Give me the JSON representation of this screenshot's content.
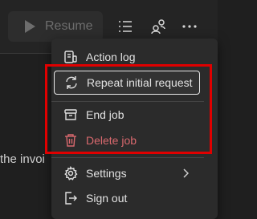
{
  "toolbar": {
    "resume_label": "Resume",
    "icons": [
      "play-icon",
      "list-icon",
      "people-icon",
      "more-icon"
    ]
  },
  "background": {
    "partial_text": "the invoi"
  },
  "menu": {
    "items": [
      {
        "label": "Action log",
        "icon": "action-log-icon"
      },
      {
        "label": "Repeat initial request",
        "icon": "repeat-icon",
        "state": "focused"
      },
      {
        "label": "End job",
        "icon": "archive-icon"
      },
      {
        "label": "Delete job",
        "icon": "trash-icon",
        "state": "danger"
      },
      {
        "label": "Settings",
        "icon": "gear-icon",
        "has_submenu": true
      },
      {
        "label": "Sign out",
        "icon": "sign-out-icon"
      }
    ]
  },
  "colors": {
    "danger": "#d9696e",
    "annotation_box": "#e00000",
    "menu_bg": "#2b2b2b"
  }
}
